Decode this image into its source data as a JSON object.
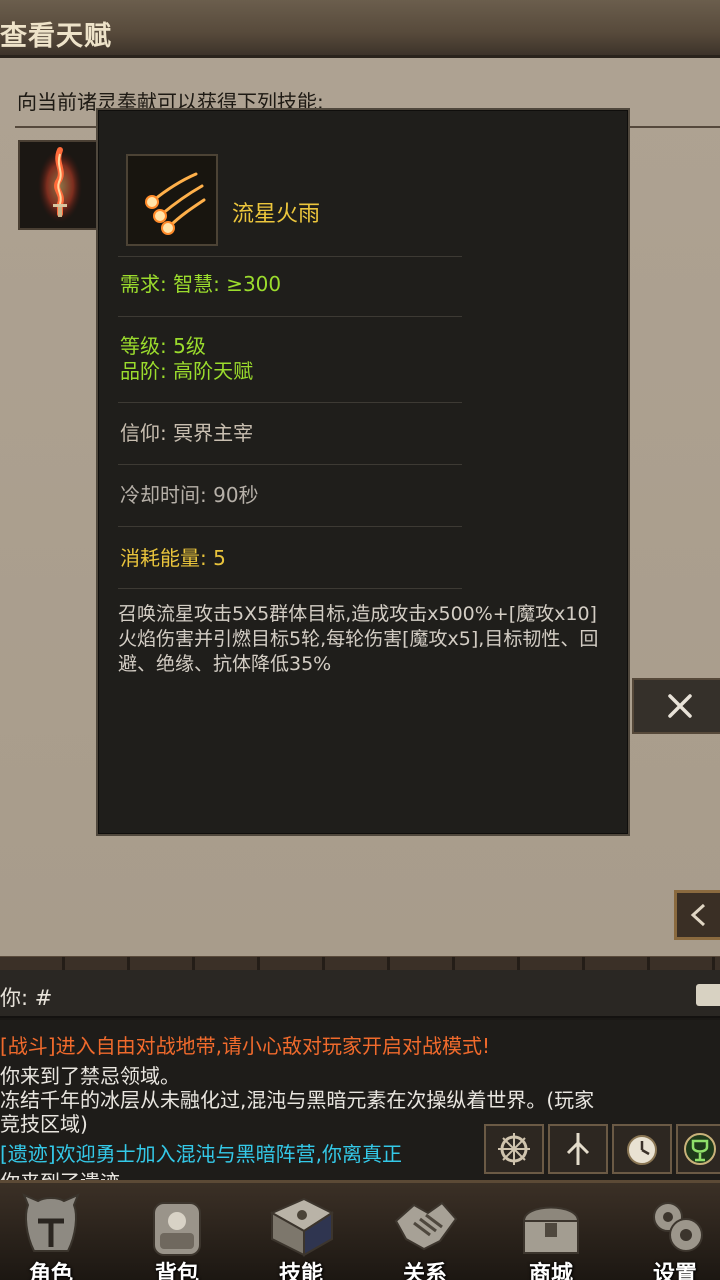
{
  "header": {
    "title": "查看天赋"
  },
  "panel": {
    "intro": "向当前诸灵奉献可以获得下列技能:",
    "close_icon": "close-icon",
    "back_icon": "chevron-left-icon"
  },
  "tooltip": {
    "skill_name": "流星火雨",
    "requirement": "需求: 智慧: ≥300",
    "level": "等级: 5级",
    "tier": "品阶: 高阶天赋",
    "faith": "信仰: 冥界主宰",
    "cooldown": "冷却时间: 90秒",
    "cost": "消耗能量: 5",
    "description": "召唤流星攻击5X5群体目标,造成攻击x500%+[魔攻x10]火焰伤害并引燃目标5轮,每轮伤害[魔攻x5],目标韧性、回避、绝缘、抗体降低35%"
  },
  "chat": {
    "input_prefix": "你: #",
    "messages": [
      "[战斗]进入自由对战地带,请小心敌对玩家开启对战模式!",
      "你来到了禁忌领域。",
      "冻结千年的冰层从未融化过,混沌与黑暗元素在次操纵着世界。(玩家",
      "竞技区域)",
      "[遗迹]欢迎勇士加入混沌与黑暗阵营,你离真正",
      "你来到了遗迹"
    ],
    "quick_icons": [
      "gear-wheel-icon",
      "swords-icon",
      "clock-icon",
      "trophy-icon"
    ]
  },
  "nav": {
    "items": [
      {
        "label": "角色",
        "icon": "helmet-icon"
      },
      {
        "label": "背包",
        "icon": "backpack-icon"
      },
      {
        "label": "技能",
        "icon": "spellbook-icon"
      },
      {
        "label": "关系",
        "icon": "handshake-icon"
      },
      {
        "label": "商城",
        "icon": "chest-icon"
      },
      {
        "label": "设置",
        "icon": "gear-icon"
      }
    ]
  },
  "colors": {
    "requirement": "#9bdc2d",
    "cost": "#e9c43c",
    "skill_name": "#ecc63c",
    "chat_system": "#f06a2c",
    "chat_relic": "#34c9e8"
  }
}
